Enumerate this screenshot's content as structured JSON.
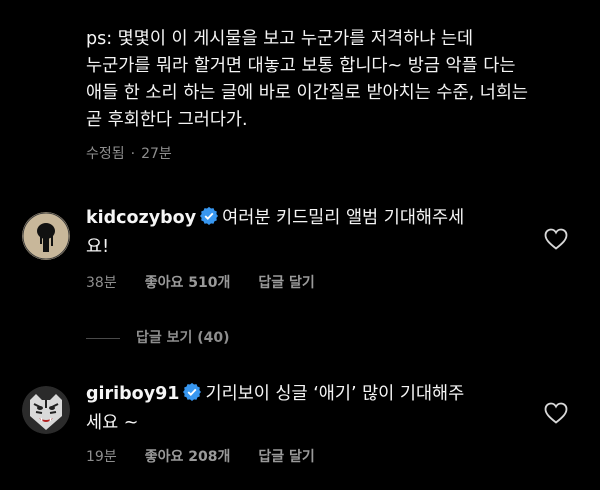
{
  "post": {
    "lines": [
      "ps: 몇몇이 이 게시물을 보고 누군가를 저격하냐 는데",
      "누군가를 뭐라 할거면 대놓고 보통 합니다~ 방금 악플 다는",
      "애들 한 소리 하는 글에 바로 이간질로 받아치는 수준, 너희는",
      "곧 후회한다 그러다가."
    ],
    "edited_label": "수정됨",
    "separator": "·",
    "time": "27분"
  },
  "comments": [
    {
      "username": "kidcozyboy",
      "verified": true,
      "text_line1": "여러분 키드밀리 앨범 기대해주세",
      "text_line2": "요!",
      "time": "38분",
      "likes_label": "좋아요 510개",
      "reply_label": "답글 달기",
      "avatar_icon": "dripping-black-drop-avatar",
      "heart_icon": "heart-outline-icon"
    },
    {
      "username": "giriboy91",
      "verified": true,
      "text_line1": "기리보이 싱글 ‘애기’ 많이 기대해주",
      "text_line2": "세요 ~",
      "time": "19분",
      "likes_label": "좋아요 208개",
      "reply_label": "답글 달기",
      "avatar_icon": "tiger-face-avatar",
      "heart_icon": "heart-outline-icon"
    }
  ],
  "view_replies_label": "답글 보기 (40)",
  "colors": {
    "background": "#000000",
    "text": "#f5f5f5",
    "muted": "#8e8e8e",
    "verified": "#3897f0"
  }
}
